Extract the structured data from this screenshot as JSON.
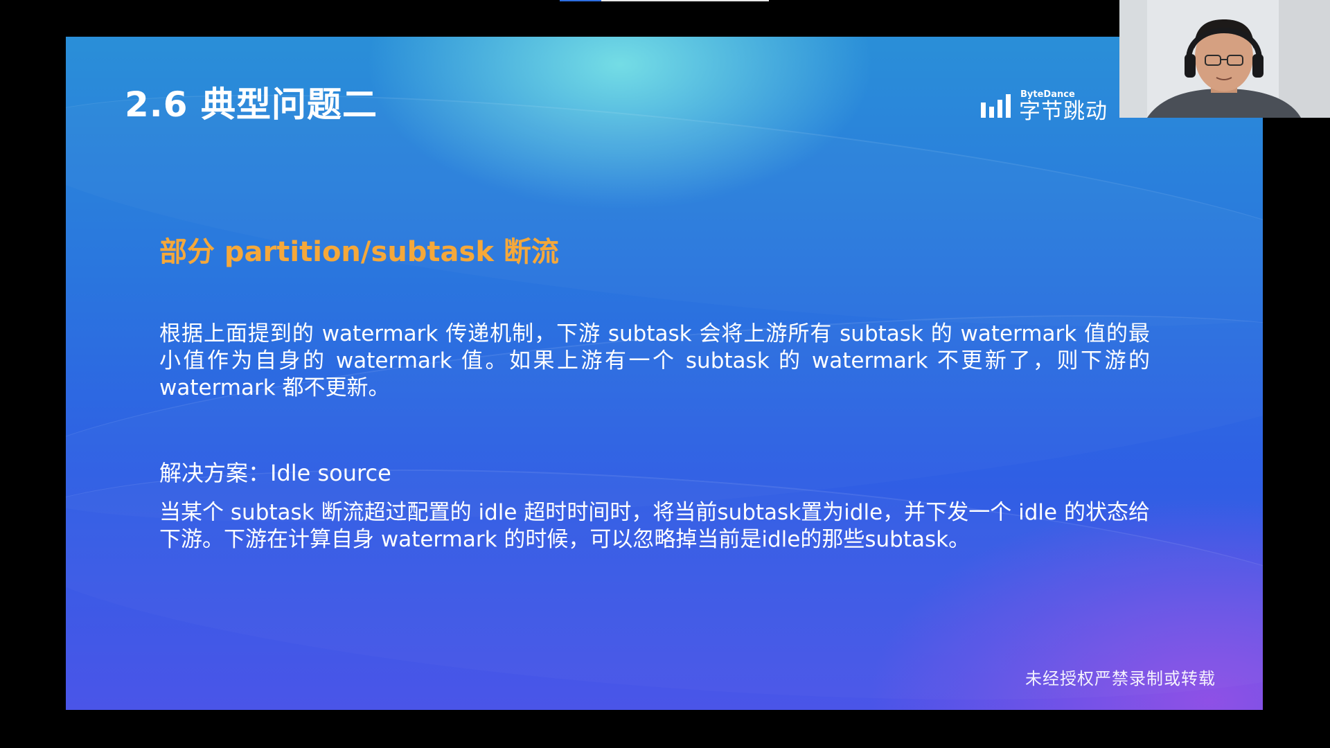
{
  "slide": {
    "title": "2.6 典型问题二",
    "subtitle": "部分 partition/subtask 断流",
    "paragraph1": "根据上面提到的 watermark 传递机制，下游 subtask 会将上游所有 subtask 的 watermark 值的最小值作为自身的 watermark 值。如果上游有一个 subtask 的 watermark 不更新了，则下游的 watermark 都不更新。",
    "solution_label": "解决方案：Idle source",
    "paragraph2": "当某个 subtask 断流超过配置的 idle 超时时间时，将当前subtask置为idle，并下发一个 idle 的状态给下游。下游在计算自身 watermark 的时候，可以忽略掉当前是idle的那些subtask。",
    "watermark": "未经授权严禁录制或转载"
  },
  "logo": {
    "en": "ByteDance",
    "cn": "字节跳动",
    "icon": "bytedance-logo-icon"
  },
  "webcam": {
    "icon": "presenter-video"
  },
  "top_progress": {
    "fraction": 0.2
  },
  "colors": {
    "title": "#ffffff",
    "subtitle_accent": "#f5a83a",
    "body_text": "#ffffff",
    "letterbox": "#000000"
  }
}
